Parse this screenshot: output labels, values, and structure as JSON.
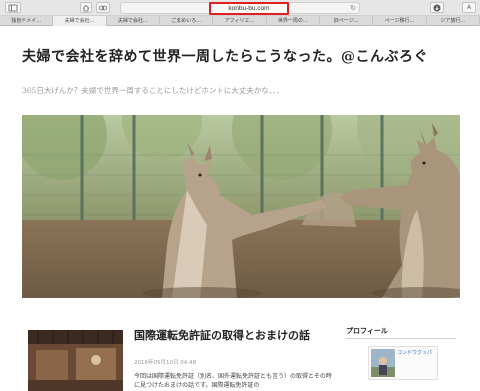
{
  "browser": {
    "url": "konbu-bu.com",
    "tabs": [
      {
        "label": "独自ドメイ...",
        "active": false
      },
      {
        "label": "夫婦で会社...",
        "active": true
      },
      {
        "label": "夫婦で会社...",
        "active": false
      },
      {
        "label": "ごまめいろ...",
        "active": false
      },
      {
        "label": "アフィリエ...",
        "active": false
      },
      {
        "label": "世界一周の...",
        "active": false
      },
      {
        "label": "旧ページ...",
        "active": false
      },
      {
        "label": "ページ移行...",
        "active": false
      },
      {
        "label": "ジア旅行...",
        "active": false
      }
    ]
  },
  "site": {
    "title": "夫婦で会社を辞めて世界一周したらこうなった。@こんぶろぐ",
    "description": "365日大げんか？夫婦で世界一周することにしたけどホントに大丈夫かな、、、"
  },
  "post": {
    "title": "国際運転免許証の取得とおまけの話",
    "date": "2016年05月10日 04:48",
    "excerpt": "今回は国際運転免許証（別名、国外運転免許証とも言う）の取得とその時に見つけたおまけの話です。国際運転免許証の"
  },
  "sidebar": {
    "widget_title": "プロフィール",
    "profile_name": "コンドウクッパ"
  }
}
